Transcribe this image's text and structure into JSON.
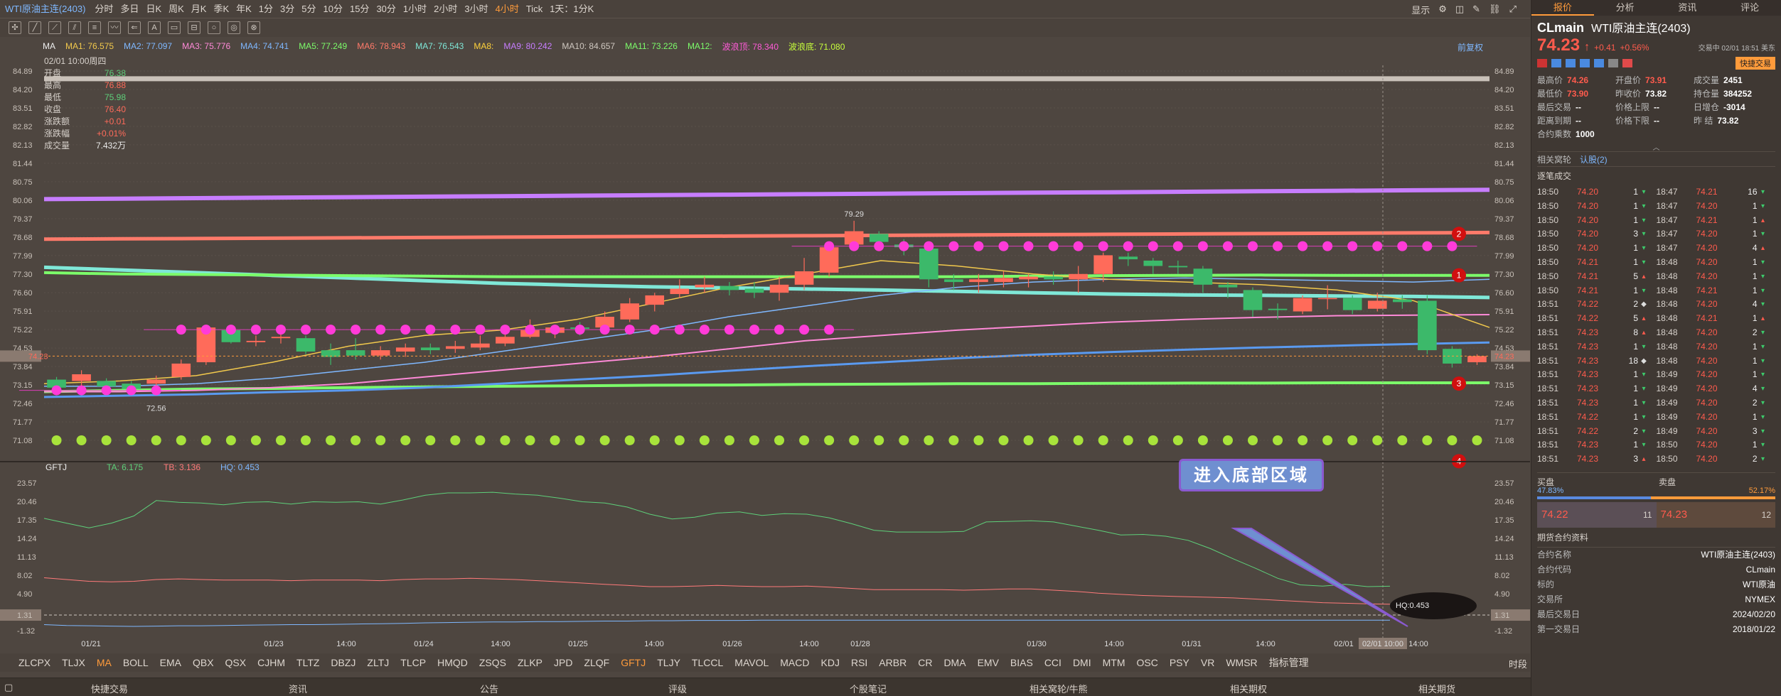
{
  "topbar": {
    "title": "WTI原油主连(2403)",
    "periods": [
      "分时",
      "多日",
      "日K",
      "周K",
      "月K",
      "季K",
      "年K",
      "1分",
      "3分",
      "5分",
      "10分",
      "15分",
      "30分",
      "1小时",
      "2小时",
      "3小时",
      "4小时",
      "Tick",
      "1天：1分K"
    ],
    "active_period": "4小时",
    "right_label": "显示"
  },
  "ma_legend": {
    "selector": "MA",
    "items": [
      {
        "label": "MA1: 76.575",
        "color": "#f2c94c"
      },
      {
        "label": "MA2: 77.097",
        "color": "#7fb8ff"
      },
      {
        "label": "MA3: 75.776",
        "color": "#ff8ad8"
      },
      {
        "label": "MA4: 74.741",
        "color": "#7fb8ff"
      },
      {
        "label": "MA5: 77.249",
        "color": "#7cfc6a"
      },
      {
        "label": "MA6: 78.943",
        "color": "#ff7a6a"
      },
      {
        "label": "MA7: 76.543",
        "color": "#7fe8d8"
      },
      {
        "label": "MA8:",
        "color": "#ffd23b"
      },
      {
        "label": "MA9: 80.242",
        "color": "#c77dff"
      },
      {
        "label": "MA10: 84.657",
        "color": "#cfc8c0"
      },
      {
        "label": "MA11: 73.226",
        "color": "#7cfc6a"
      },
      {
        "label": "MA12:",
        "color": "#7cfc6a"
      },
      {
        "label": "波浪顶: 78.340",
        "color": "#ff5bd8"
      },
      {
        "label": "波浪底: 71.080",
        "color": "#c7ff3b"
      }
    ],
    "restore": "前复权"
  },
  "infobox": {
    "date": "02/01 10:00周四",
    "rows": [
      {
        "k": "开盘",
        "v": "76.38",
        "c": "green"
      },
      {
        "k": "最高",
        "v": "76.88",
        "c": "red"
      },
      {
        "k": "最低",
        "v": "75.98",
        "c": "green"
      },
      {
        "k": "收盘",
        "v": "76.40",
        "c": "red"
      },
      {
        "k": "涨跌额",
        "v": "+0.01",
        "c": "red"
      },
      {
        "k": "涨跌幅",
        "v": "+0.01%",
        "c": "red"
      },
      {
        "k": "成交量",
        "v": "7.432万",
        "c": "white"
      }
    ]
  },
  "chart_data": [
    {
      "type": "candlestick",
      "title": "",
      "ylim": [
        71.08,
        84.89
      ],
      "y_ticks": [
        "84.89",
        "84.20",
        "83.51",
        "82.82",
        "82.13",
        "81.44",
        "80.75",
        "80.06",
        "79.37",
        "78.68",
        "77.99",
        "77.30",
        "76.60",
        "75.91",
        "75.22",
        "74.53",
        "73.84",
        "73.15",
        "72.46",
        "71.77",
        "71.08"
      ],
      "x_tick_labels": [
        "01/21",
        "01/23",
        "14:00",
        "01/24",
        "14:00",
        "01/25",
        "14:00",
        "01/26",
        "14:00",
        "01/28",
        "01/30",
        "14:00",
        "01/31",
        "14:00",
        "02/01",
        "02/01 10:00",
        "14:00"
      ],
      "candles": [
        {
          "o": 73.35,
          "c": 73.05,
          "h": 73.45,
          "l": 72.95
        },
        {
          "o": 73.3,
          "c": 73.55,
          "h": 73.7,
          "l": 73.1
        },
        {
          "o": 73.3,
          "c": 73.1,
          "h": 73.4,
          "l": 72.9
        },
        {
          "o": 73.2,
          "c": 73.0,
          "h": 73.3,
          "l": 72.8
        },
        {
          "o": 73.2,
          "c": 73.35,
          "h": 73.5,
          "l": 73.0
        },
        {
          "o": 73.45,
          "c": 73.95,
          "h": 74.1,
          "l": 73.35
        },
        {
          "o": 74.0,
          "c": 75.3,
          "h": 75.4,
          "l": 73.9
        },
        {
          "o": 75.2,
          "c": 74.75,
          "h": 75.4,
          "l": 74.7
        },
        {
          "o": 74.75,
          "c": 74.8,
          "h": 75.0,
          "l": 74.6
        },
        {
          "o": 74.9,
          "c": 74.95,
          "h": 75.1,
          "l": 74.7
        },
        {
          "o": 74.9,
          "c": 74.4,
          "h": 75.0,
          "l": 74.3
        },
        {
          "o": 74.45,
          "c": 74.2,
          "h": 74.7,
          "l": 73.9
        },
        {
          "o": 74.45,
          "c": 74.25,
          "h": 74.9,
          "l": 74.1
        },
        {
          "o": 74.25,
          "c": 74.45,
          "h": 74.6,
          "l": 74.1
        },
        {
          "o": 74.4,
          "c": 74.55,
          "h": 74.7,
          "l": 74.2
        },
        {
          "o": 74.55,
          "c": 74.45,
          "h": 74.7,
          "l": 74.3
        },
        {
          "o": 74.5,
          "c": 74.6,
          "h": 74.8,
          "l": 74.35
        },
        {
          "o": 74.55,
          "c": 74.7,
          "h": 75.0,
          "l": 74.45
        },
        {
          "o": 74.7,
          "c": 74.95,
          "h": 75.1,
          "l": 74.6
        },
        {
          "o": 74.95,
          "c": 75.2,
          "h": 75.6,
          "l": 74.9
        },
        {
          "o": 75.1,
          "c": 75.3,
          "h": 75.4,
          "l": 74.9
        },
        {
          "o": 75.3,
          "c": 75.25,
          "h": 75.5,
          "l": 75.0
        },
        {
          "o": 75.3,
          "c": 75.7,
          "h": 75.9,
          "l": 75.2
        },
        {
          "o": 75.6,
          "c": 76.2,
          "h": 76.4,
          "l": 75.5
        },
        {
          "o": 76.15,
          "c": 76.5,
          "h": 76.6,
          "l": 75.9
        },
        {
          "o": 76.55,
          "c": 76.75,
          "h": 77.1,
          "l": 76.4
        },
        {
          "o": 76.8,
          "c": 76.9,
          "h": 77.2,
          "l": 76.6
        },
        {
          "o": 76.85,
          "c": 76.7,
          "h": 77.0,
          "l": 76.5
        },
        {
          "o": 76.75,
          "c": 76.6,
          "h": 77.0,
          "l": 76.4
        },
        {
          "o": 76.6,
          "c": 76.9,
          "h": 77.2,
          "l": 76.3
        },
        {
          "o": 76.9,
          "c": 77.4,
          "h": 77.9,
          "l": 76.7
        },
        {
          "o": 77.35,
          "c": 78.3,
          "h": 78.5,
          "l": 77.2
        },
        {
          "o": 78.4,
          "c": 78.9,
          "h": 79.29,
          "l": 78.2
        },
        {
          "o": 78.8,
          "c": 78.5,
          "h": 78.9,
          "l": 78.2
        },
        {
          "o": 78.4,
          "c": 78.3,
          "h": 78.6,
          "l": 78.0
        },
        {
          "o": 78.25,
          "c": 77.1,
          "h": 78.4,
          "l": 76.8
        },
        {
          "o": 77.1,
          "c": 77.0,
          "h": 77.3,
          "l": 76.7
        },
        {
          "o": 77.0,
          "c": 77.1,
          "h": 77.3,
          "l": 76.6
        },
        {
          "o": 77.0,
          "c": 77.15,
          "h": 77.4,
          "l": 76.8
        },
        {
          "o": 77.1,
          "c": 77.2,
          "h": 77.3,
          "l": 76.8
        },
        {
          "o": 77.2,
          "c": 77.1,
          "h": 77.4,
          "l": 76.9
        },
        {
          "o": 77.1,
          "c": 77.3,
          "h": 77.6,
          "l": 76.6
        },
        {
          "o": 77.3,
          "c": 78.0,
          "h": 78.1,
          "l": 77.0
        },
        {
          "o": 77.95,
          "c": 77.85,
          "h": 78.1,
          "l": 77.6
        },
        {
          "o": 77.8,
          "c": 77.6,
          "h": 77.9,
          "l": 77.3
        },
        {
          "o": 77.6,
          "c": 77.55,
          "h": 77.8,
          "l": 77.3
        },
        {
          "o": 77.5,
          "c": 76.9,
          "h": 77.6,
          "l": 76.6
        },
        {
          "o": 76.9,
          "c": 76.8,
          "h": 77.0,
          "l": 76.4
        },
        {
          "o": 76.7,
          "c": 75.95,
          "h": 76.8,
          "l": 75.7
        },
        {
          "o": 76.0,
          "c": 75.95,
          "h": 76.2,
          "l": 75.6
        },
        {
          "o": 75.9,
          "c": 76.4,
          "h": 76.5,
          "l": 75.8
        },
        {
          "o": 76.38,
          "c": 76.4,
          "h": 76.88,
          "l": 75.98
        },
        {
          "o": 76.4,
          "c": 75.95,
          "h": 76.5,
          "l": 75.8
        },
        {
          "o": 76.0,
          "c": 76.3,
          "h": 76.6,
          "l": 75.9
        },
        {
          "o": 76.35,
          "c": 76.25,
          "h": 76.5,
          "l": 76.0
        },
        {
          "o": 76.3,
          "c": 74.45,
          "h": 76.5,
          "l": 74.3
        },
        {
          "o": 74.5,
          "c": 73.95,
          "h": 74.6,
          "l": 73.8
        },
        {
          "o": 74.0,
          "c": 74.23,
          "h": 74.3,
          "l": 73.9
        }
      ],
      "annotations": [
        "79.29",
        "72.56"
      ],
      "circle_markers": [
        "2",
        "1",
        "3",
        "4"
      ],
      "last_price": "74.23"
    },
    {
      "type": "line",
      "title": "GFTJ",
      "ylim": [
        -1.32,
        23.57
      ],
      "y_ticks": [
        "23.57",
        "20.46",
        "17.35",
        "14.24",
        "11.13",
        "8.02",
        "4.90",
        "1.31",
        "-1.32"
      ],
      "series": [
        {
          "name": "TA: 6.175",
          "color": "#5ed07a",
          "values": [
            17.6,
            16.8,
            16.0,
            16.8,
            18.0,
            20.6,
            20.3,
            20.2,
            19.9,
            20.3,
            20.4,
            20.0,
            20.4,
            20.3,
            20.4,
            20.0,
            20.7,
            21.5,
            21.9,
            21.9,
            22.0,
            21.7,
            21.5,
            21.0,
            20.4,
            20.2,
            19.5,
            18.3,
            17.5,
            17.8,
            18.5,
            18.7,
            18.1,
            18.4,
            18.3,
            17.7,
            16.7,
            15.6,
            15.3,
            15.3,
            15.3,
            15.4,
            17.0,
            17.1,
            17.2,
            17.0,
            16.3,
            15.6,
            14.8,
            14.9,
            14.6,
            13.9,
            12.5,
            10.8,
            9.2,
            7.5,
            6.4,
            6.2,
            6.5,
            6.1,
            6.175
          ]
        },
        {
          "name": "TB: 3.136",
          "color": "#ff7a7a",
          "values": [
            7.6,
            7.3,
            7.0,
            6.9,
            7.0,
            7.3,
            7.4,
            7.3,
            7.2,
            7.2,
            7.2,
            7.1,
            7.2,
            7.2,
            7.2,
            7.1,
            7.3,
            7.4,
            7.4,
            7.5,
            7.4,
            7.3,
            7.1,
            6.9,
            6.7,
            6.5,
            6.3,
            6.1,
            6.1,
            6.2,
            6.3,
            6.2,
            6.1,
            6.1,
            6.2,
            6.0,
            5.8,
            5.6,
            5.6,
            5.6,
            5.6,
            5.5,
            5.6,
            5.7,
            5.7,
            5.5,
            5.3,
            5.0,
            4.8,
            4.6,
            4.5,
            4.4,
            4.3,
            4.2,
            4.0,
            3.8,
            3.6,
            3.4,
            3.3,
            3.2,
            3.136
          ]
        },
        {
          "name": "HQ: 0.453",
          "color": "#7fb8ff",
          "values": [
            -0.3,
            -0.45,
            -0.5,
            -0.55,
            -0.6,
            -0.55,
            -0.5,
            -0.5,
            -0.45,
            -0.4,
            -0.35,
            -0.3,
            -0.3,
            -0.25,
            -0.2,
            -0.15,
            -0.1,
            0.0,
            0.05,
            0.1,
            0.15,
            0.15,
            0.2,
            0.2,
            0.25,
            0.3,
            0.3,
            0.35,
            0.35,
            0.4,
            0.4,
            0.4,
            0.45,
            0.45,
            0.45,
            0.45,
            0.45,
            0.45,
            0.45,
            0.45,
            0.45,
            0.45,
            0.45,
            0.45,
            0.45,
            0.45,
            0.45,
            0.45,
            0.45,
            0.45,
            0.45,
            0.45,
            0.45,
            0.45,
            0.45,
            0.45,
            0.45,
            0.45,
            0.45,
            0.45,
            0.453
          ]
        }
      ],
      "ref_line": "1.31",
      "callout": "进入底部区域",
      "bubble": "HQ:0.453"
    }
  ],
  "indicator_tabs": [
    "ZLCPX",
    "TLJX",
    "MA",
    "BOLL",
    "EMA",
    "QBX",
    "QSX",
    "CJHM",
    "TLTZ",
    "DBZJ",
    "ZLTJ",
    "TLCP",
    "HMQD",
    "ZSQS",
    "ZLKP",
    "JPD",
    "ZLQF",
    "GFTJ",
    "TLJY",
    "TLCCL",
    "MAVOL",
    "MACD",
    "KDJ",
    "RSI",
    "ARBR",
    "CR",
    "DMA",
    "EMV",
    "BIAS",
    "CCI",
    "DMI",
    "MTM",
    "OSC",
    "PSY",
    "VR",
    "WMSR",
    "指标管理"
  ],
  "indicator_active": [
    "MA",
    "GFTJ"
  ],
  "indicator_right": "时段",
  "bottom_bar": [
    "快捷交易",
    "资讯",
    "公告",
    "评级",
    "个股笔记",
    "相关窝轮/牛熊",
    "相关期权",
    "相关期货"
  ],
  "right_panel": {
    "tabs": [
      "报价",
      "分析",
      "资讯",
      "评论"
    ],
    "symbol": "CLmain",
    "name": "WTI原油主连(2403)",
    "price": "74.23",
    "change": "+0.41",
    "change_pct": "+0.56%",
    "time": "交易中 02/01 18:51 美东",
    "quick_trade": "快捷交易",
    "stats": [
      [
        {
          "k": "最高价",
          "v": "74.26",
          "c": "red"
        },
        {
          "k": "开盘价",
          "v": "73.91",
          "c": "red"
        },
        {
          "k": "成交量",
          "v": "2451",
          "c": "white"
        }
      ],
      [
        {
          "k": "最低价",
          "v": "73.90",
          "c": "red"
        },
        {
          "k": "昨收价",
          "v": "73.82",
          "c": "white"
        },
        {
          "k": "持仓量",
          "v": "384252",
          "c": "white"
        }
      ],
      [
        {
          "k": "最后交易",
          "v": "--",
          "c": "white"
        },
        {
          "k": "价格上限",
          "v": "--",
          "c": "white"
        },
        {
          "k": "日增仓",
          "v": "-3014",
          "c": "white"
        }
      ],
      [
        {
          "k": "距离到期",
          "v": "--",
          "c": "white"
        },
        {
          "k": "价格下限",
          "v": "--",
          "c": "white"
        },
        {
          "k": "昨 结",
          "v": "73.82",
          "c": "white"
        }
      ],
      [
        {
          "k": "合约乘数",
          "v": "1000",
          "c": "white"
        }
      ]
    ],
    "related": "相关窝轮",
    "related2": "认股(2)",
    "ticks_title": "逐笔成交",
    "ticks": [
      [
        "18:50",
        "74.20",
        "1",
        "g",
        "18:47",
        "74.21",
        "16",
        "g"
      ],
      [
        "18:50",
        "74.20",
        "1",
        "g",
        "18:47",
        "74.20",
        "1",
        "g"
      ],
      [
        "18:50",
        "74.20",
        "1",
        "g",
        "18:47",
        "74.21",
        "1",
        "r"
      ],
      [
        "18:50",
        "74.20",
        "3",
        "g",
        "18:47",
        "74.20",
        "1",
        "g"
      ],
      [
        "18:50",
        "74.20",
        "1",
        "g",
        "18:47",
        "74.20",
        "4",
        "r"
      ],
      [
        "18:50",
        "74.21",
        "1",
        "g",
        "18:48",
        "74.20",
        "1",
        "g"
      ],
      [
        "18:50",
        "74.21",
        "5",
        "r",
        "18:48",
        "74.20",
        "1",
        "g"
      ],
      [
        "18:50",
        "74.21",
        "1",
        "g",
        "18:48",
        "74.21",
        "1",
        "g"
      ],
      [
        "18:51",
        "74.22",
        "2",
        "d",
        "18:48",
        "74.20",
        "4",
        "g"
      ],
      [
        "18:51",
        "74.22",
        "5",
        "r",
        "18:48",
        "74.21",
        "1",
        "r"
      ],
      [
        "18:51",
        "74.23",
        "8",
        "r",
        "18:48",
        "74.20",
        "2",
        "g"
      ],
      [
        "18:51",
        "74.23",
        "1",
        "g",
        "18:48",
        "74.20",
        "1",
        "g"
      ],
      [
        "18:51",
        "74.23",
        "18",
        "d",
        "18:48",
        "74.20",
        "1",
        "g"
      ],
      [
        "18:51",
        "74.23",
        "1",
        "g",
        "18:49",
        "74.20",
        "1",
        "g"
      ],
      [
        "18:51",
        "74.23",
        "1",
        "g",
        "18:49",
        "74.20",
        "4",
        "g"
      ],
      [
        "18:51",
        "74.23",
        "1",
        "g",
        "18:49",
        "74.20",
        "2",
        "g"
      ],
      [
        "18:51",
        "74.22",
        "1",
        "g",
        "18:49",
        "74.20",
        "1",
        "g"
      ],
      [
        "18:51",
        "74.22",
        "2",
        "g",
        "18:49",
        "74.20",
        "3",
        "g"
      ],
      [
        "18:51",
        "74.23",
        "1",
        "g",
        "18:50",
        "74.20",
        "1",
        "g"
      ],
      [
        "18:51",
        "74.23",
        "3",
        "r",
        "18:50",
        "74.20",
        "2",
        "g"
      ]
    ],
    "buy_label": "买盘",
    "sell_label": "卖盘",
    "buy_pct": "47.83%",
    "sell_pct": "52.17%",
    "bid": "74.22",
    "bid_qty": "11",
    "ask": "74.23",
    "ask_qty": "12",
    "futures_title": "期货合约资料",
    "futures": [
      {
        "k": "合约名称",
        "v": "WTI原油主连(2403)"
      },
      {
        "k": "合约代码",
        "v": "CLmain"
      },
      {
        "k": "标的",
        "v": "WTI原油"
      },
      {
        "k": "交易所",
        "v": "NYMEX"
      },
      {
        "k": "最后交易日",
        "v": "2024/02/20"
      },
      {
        "k": "第一交易日",
        "v": "2018/01/22"
      }
    ]
  },
  "colors": {
    "up": "#ff6b5a",
    "down": "#3cb96a",
    "bg": "#4e4640"
  }
}
